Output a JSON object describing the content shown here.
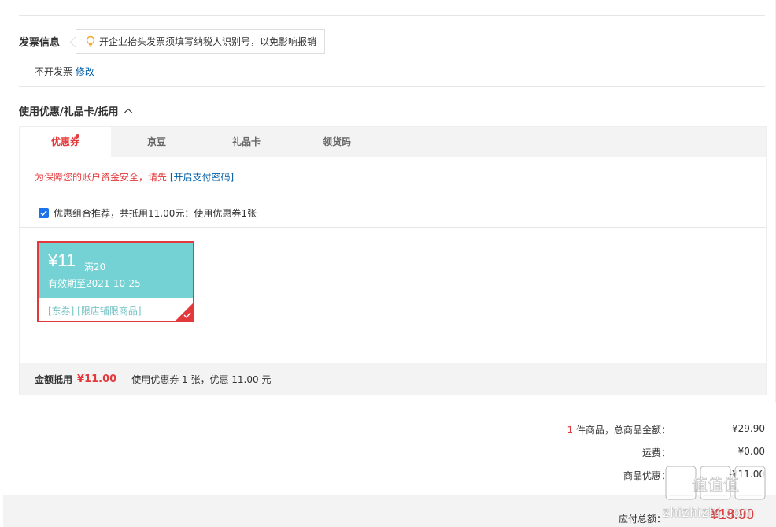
{
  "invoice": {
    "title": "发票信息",
    "tip": "开企业抬头发票须填写纳税人识别号，以免影响报销",
    "status": "不开发票",
    "edit_label": "修改"
  },
  "coupon_section": {
    "title": "使用优惠/礼品卡/抵用",
    "tabs": [
      {
        "label": "优惠券"
      },
      {
        "label": "京豆"
      },
      {
        "label": "礼品卡"
      },
      {
        "label": "领货码"
      }
    ],
    "warning_text": "为保障您的账户资金安全，请先",
    "warning_link": "[开启支付密码]",
    "recommend_text": "优惠组合推荐，共抵用11.00元：使用优惠券1张",
    "coupon": {
      "price": "¥11",
      "condition": "满20",
      "validity": "有效期至2021-10-25",
      "tags": "[东券]  [限店铺限商品]"
    },
    "summary_label": "金额抵用",
    "summary_amount": "¥11.00",
    "summary_text": "使用优惠券 1 张，优惠 11.00 元"
  },
  "totals": {
    "count": "1",
    "goods_label": "件商品，总商品金额：",
    "goods_value": "¥29.90",
    "shipping_label": "运费：",
    "shipping_value": "¥0.00",
    "discount_label": "商品优惠：",
    "discount_value": "-¥11.00",
    "payable_label": "应付总额：",
    "payable_value": "¥18.90"
  },
  "watermark": {
    "logo_text": "值值值",
    "url": "zhizhizhi.com"
  },
  "colors": {
    "accent": "#e4393c",
    "link": "#005ea7",
    "coupon_bg": "#74d2d4"
  }
}
